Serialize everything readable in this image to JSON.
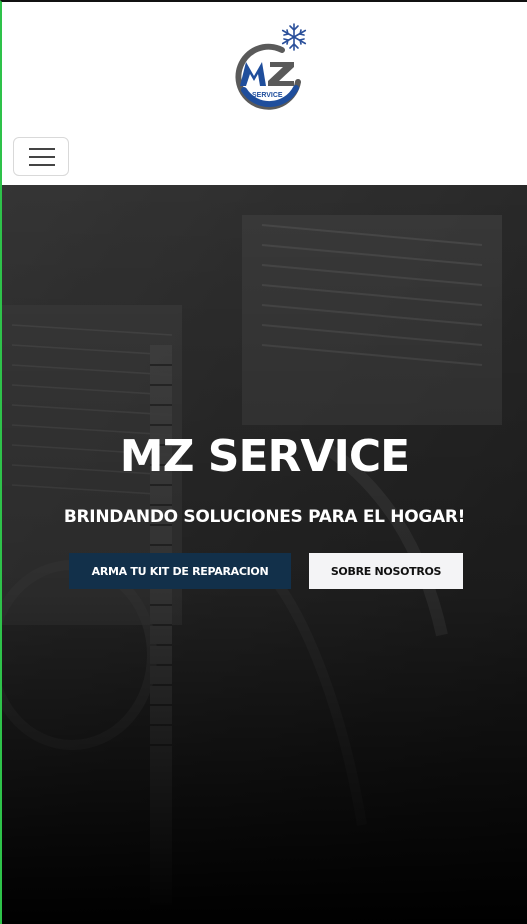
{
  "header": {
    "logo_text": "MZ",
    "logo_subtext": "SERVICE",
    "menu_toggle_label": "Toggle navigation"
  },
  "hero": {
    "title": "MZ SERVICE",
    "subtitle": "BRINDANDO SOLUCIONES PARA EL HOGAR!",
    "primary_button": "ARMA TU KIT DE REPARACION",
    "secondary_button": "SOBRE NOSOTROS"
  },
  "colors": {
    "brand_blue": "#1f4e9c",
    "brand_gray": "#5a5a5a",
    "primary_button_bg": "#12304a",
    "secondary_button_bg": "#f4f4f6",
    "accent_border": "#2ec24a"
  },
  "icons": {
    "logo_decoration": "snowflake-icon",
    "menu": "hamburger-icon"
  }
}
